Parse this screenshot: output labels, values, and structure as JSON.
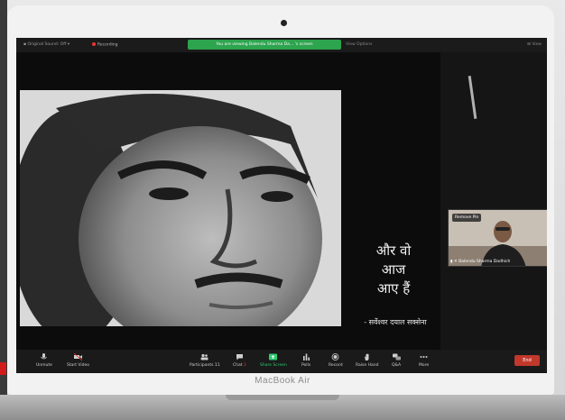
{
  "laptop": {
    "brand": "MacBook Air"
  },
  "topbar": {
    "original_sound": "Original Sound: Off",
    "recording": "Recording",
    "viewing_banner": "You are viewing Balendu Sharma Da... 's screen",
    "view_options": "View Options",
    "view_label": "View"
  },
  "slide": {
    "poem_lines": [
      "और वो",
      "आज",
      "आए हैं"
    ],
    "poet": "- सर्वेश्वर दयाल सक्सेना"
  },
  "video_thumb": {
    "remove_pin": "Remove Pin",
    "participant_name": "Balendu Sharma Dadhich"
  },
  "toolbar": {
    "unmute": "Unmute",
    "start_video": "Start Video",
    "participants": "Participants",
    "participants_count": "11",
    "chat": "Chat",
    "chat_badge": "2",
    "share_screen": "Share Screen",
    "polls": "Polls",
    "record": "Record",
    "raise_hand": "Raise Hand",
    "qa": "Q&A",
    "more": "More",
    "end": "End"
  },
  "colors": {
    "share_green": "#2ecc71",
    "banner_green": "#2da44e",
    "end_red": "#c0392b",
    "recording_red": "#e33333"
  }
}
